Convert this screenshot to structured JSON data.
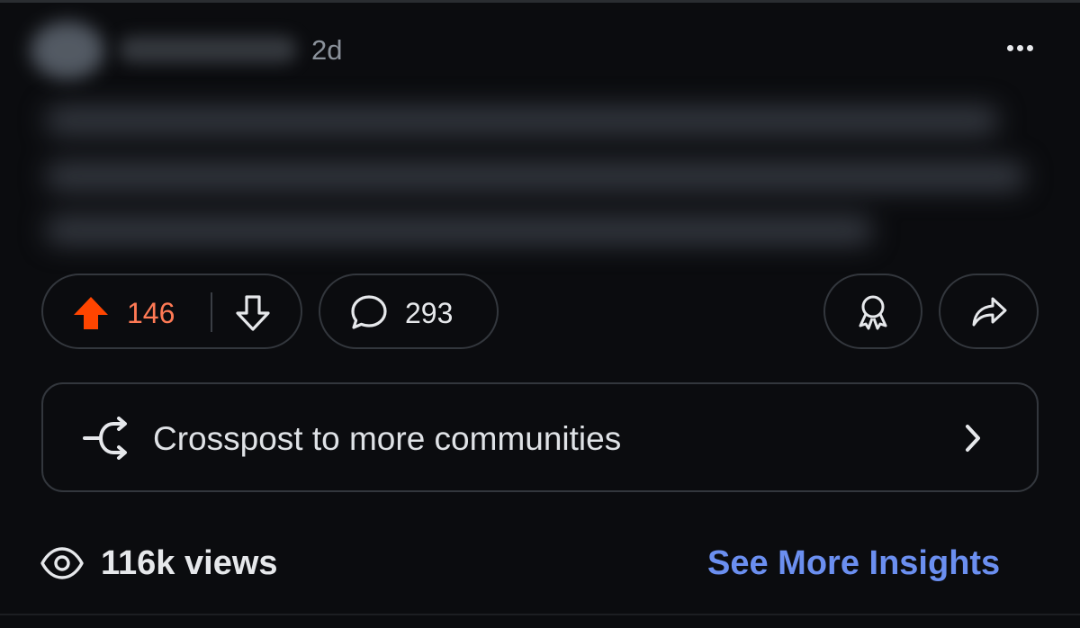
{
  "post": {
    "timestamp": "2d",
    "more_icon": "more-horizontal-icon"
  },
  "actions": {
    "upvote_icon": "upvote-arrow-icon",
    "upvote_color": "#ff4500",
    "score": "146",
    "score_color": "#ff7a55",
    "downvote_icon": "downvote-arrow-icon",
    "comment_icon": "speech-bubble-icon",
    "comment_count": "293",
    "award_icon": "award-ribbon-icon",
    "share_icon": "share-arrow-icon"
  },
  "crosspost": {
    "icon": "crosspost-split-arrow-icon",
    "label": "Crosspost to more communities",
    "chevron_icon": "chevron-right-icon"
  },
  "stats": {
    "views_icon": "eye-icon",
    "views_label": "116k views",
    "insights_link": "See More Insights",
    "link_color": "#6b8ff0"
  }
}
